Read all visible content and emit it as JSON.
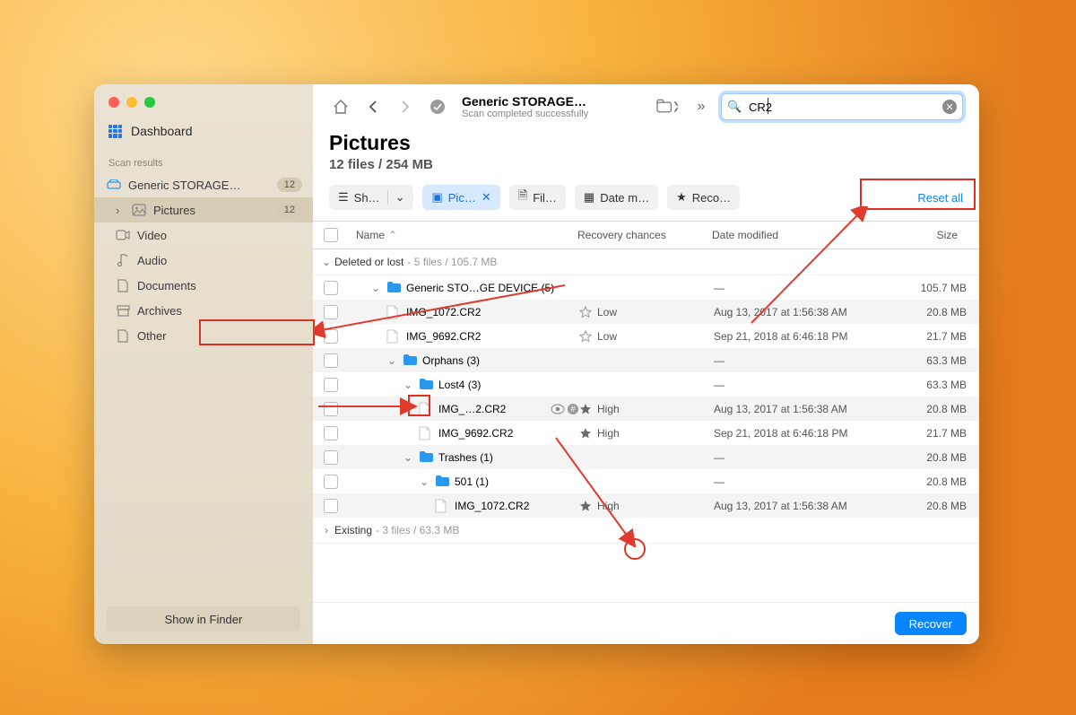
{
  "toolbar": {
    "title": "Generic STORAGE…",
    "subtitle": "Scan completed successfully",
    "search_value": "CR2"
  },
  "sidebar": {
    "dashboard": "Dashboard",
    "section": "Scan results",
    "items": [
      {
        "label": "Generic STORAGE…",
        "badge": "12"
      },
      {
        "label": "Pictures",
        "badge": "12"
      },
      {
        "label": "Video"
      },
      {
        "label": "Audio"
      },
      {
        "label": "Documents"
      },
      {
        "label": "Archives"
      },
      {
        "label": "Other"
      }
    ],
    "show_in_finder": "Show in Finder"
  },
  "header": {
    "title": "Pictures",
    "subtitle": "12 files / 254 MB"
  },
  "filters": {
    "show": "Sh…",
    "pictures": "Pic…",
    "file": "Fil…",
    "date": "Date m…",
    "recovery": "Reco…",
    "reset": "Reset all"
  },
  "columns": {
    "name": "Name",
    "recovery": "Recovery chances",
    "date": "Date modified",
    "size": "Size"
  },
  "groups": [
    {
      "label": "Deleted or lost",
      "meta": "5 files / 105.7 MB",
      "open": true
    },
    {
      "label": "Existing",
      "meta": "3 files / 63.3 MB",
      "open": false
    }
  ],
  "rows": [
    {
      "indent": 0,
      "chev": "down",
      "folder": true,
      "name": "Generic STO…GE DEVICE (5)",
      "recovery": "",
      "date": "—",
      "size": "105.7 MB"
    },
    {
      "indent": 1,
      "file": true,
      "name": "IMG_1072.CR2",
      "recovery": "Low",
      "star": "empty",
      "date": "Aug 13, 2017 at 1:56:38 AM",
      "size": "20.8 MB"
    },
    {
      "indent": 1,
      "file": true,
      "name": "IMG_9692.CR2",
      "recovery": "Low",
      "star": "empty",
      "date": "Sep 21, 2018 at 6:46:18 PM",
      "size": "21.7 MB"
    },
    {
      "indent": 1,
      "chev": "down",
      "folder": true,
      "name": "Orphans (3)",
      "recovery": "",
      "date": "—",
      "size": "63.3 MB"
    },
    {
      "indent": 2,
      "chev": "down",
      "folder": true,
      "name": "Lost4 (3)",
      "recovery": "",
      "date": "—",
      "size": "63.3 MB"
    },
    {
      "indent": 3,
      "file": true,
      "name": "IMG_…2.CR2",
      "recovery": "High",
      "star": "fill",
      "eye": true,
      "date": "Aug 13, 2017 at 1:56:38 AM",
      "size": "20.8 MB"
    },
    {
      "indent": 3,
      "file": true,
      "name": "IMG_9692.CR2",
      "recovery": "High",
      "star": "fill",
      "date": "Sep 21, 2018 at 6:46:18 PM",
      "size": "21.7 MB"
    },
    {
      "indent": 2,
      "chev": "down",
      "folder": true,
      "name": "Trashes (1)",
      "recovery": "",
      "date": "—",
      "size": "20.8 MB"
    },
    {
      "indent": 3,
      "chev": "down",
      "folder": true,
      "name": "501 (1)",
      "recovery": "",
      "date": "—",
      "size": "20.8 MB"
    },
    {
      "indent": 4,
      "file": true,
      "name": "IMG_1072.CR2",
      "recovery": "High",
      "star": "fill",
      "date": "Aug 13, 2017 at 1:56:38 AM",
      "size": "20.8 MB"
    }
  ],
  "footer": {
    "recover": "Recover"
  }
}
